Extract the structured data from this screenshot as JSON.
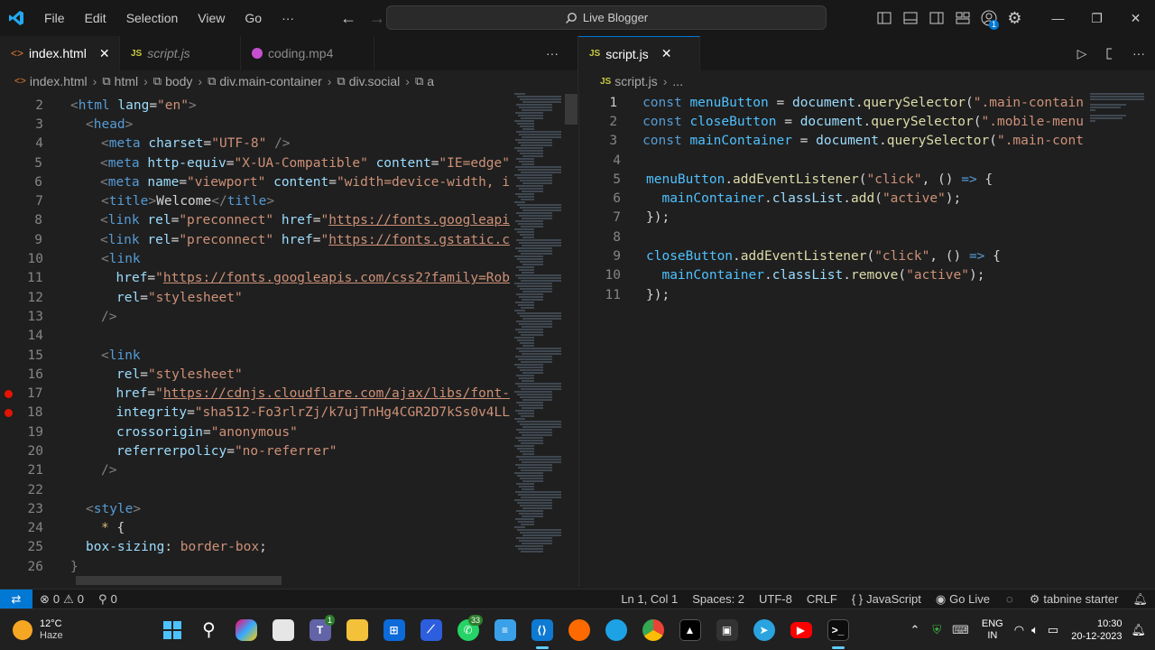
{
  "titlebar": {
    "menus": [
      "File",
      "Edit",
      "Selection",
      "View",
      "Go",
      "···"
    ],
    "search": "Live Blogger",
    "account_badge": "1"
  },
  "left_tabs": [
    {
      "label": "index.html",
      "icon": "html-icon",
      "active": true
    },
    {
      "label": "script.js",
      "icon": "js-icon",
      "active": false
    },
    {
      "label": "coding.mp4",
      "icon": "media-icon",
      "active": false
    }
  ],
  "left_tabs_more": "···",
  "right_tabs": [
    {
      "label": "script.js",
      "icon": "js-icon",
      "active": true
    }
  ],
  "left_breadcrumb": [
    "index.html",
    "html",
    "body",
    "div.main-container",
    "div.social",
    "a"
  ],
  "right_breadcrumb": [
    "script.js",
    "..."
  ],
  "html_lines": [
    {
      "n": "2",
      "html": "<span class=\"tag\">&lt;</span><span class=\"tname\">html</span> <span class=\"attr\">lang</span>=<span class=\"str\">\"en\"</span><span class=\"tag\">&gt;</span>",
      "indent": 0
    },
    {
      "n": "3",
      "html": "<span class=\"tag\">&lt;</span><span class=\"tname\">head</span><span class=\"tag\">&gt;</span>",
      "indent": 1
    },
    {
      "n": "4",
      "html": "<span class=\"tag\">&lt;</span><span class=\"tname\">meta</span> <span class=\"attr\">charset</span>=<span class=\"str\">\"UTF-8\"</span> <span class=\"tag\">/&gt;</span>",
      "indent": 2
    },
    {
      "n": "5",
      "html": "<span class=\"tag\">&lt;</span><span class=\"tname\">meta</span> <span class=\"attr\">http-equiv</span>=<span class=\"str\">\"X-UA-Compatible\"</span> <span class=\"attr\">content</span>=<span class=\"str\">\"IE=edge\"</span>",
      "indent": 2
    },
    {
      "n": "6",
      "html": "<span class=\"tag\">&lt;</span><span class=\"tname\">meta</span> <span class=\"attr\">name</span>=<span class=\"str\">\"viewport\"</span> <span class=\"attr\">content</span>=<span class=\"str\">\"width=device-width, i</span>",
      "indent": 2
    },
    {
      "n": "7",
      "html": "<span class=\"tag\">&lt;</span><span class=\"tname\">title</span><span class=\"tag\">&gt;</span>Welcome<span class=\"tag\">&lt;/</span><span class=\"tname\">title</span><span class=\"tag\">&gt;</span>",
      "indent": 2
    },
    {
      "n": "8",
      "html": "<span class=\"tag\">&lt;</span><span class=\"tname\">link</span> <span class=\"attr\">rel</span>=<span class=\"str\">\"preconnect\"</span> <span class=\"attr\">href</span>=<span class=\"str\">\"</span><span class=\"url\">https://fonts.googleapi</span>",
      "indent": 2
    },
    {
      "n": "9",
      "html": "<span class=\"tag\">&lt;</span><span class=\"tname\">link</span> <span class=\"attr\">rel</span>=<span class=\"str\">\"preconnect\"</span> <span class=\"attr\">href</span>=<span class=\"str\">\"</span><span class=\"url\">https://fonts.gstatic.c</span>",
      "indent": 2
    },
    {
      "n": "10",
      "html": "<span class=\"tag\">&lt;</span><span class=\"tname\">link</span>",
      "indent": 2
    },
    {
      "n": "11",
      "html": "<span class=\"attr\">href</span>=<span class=\"str\">\"</span><span class=\"url\">https://fonts.googleapis.com/css2?family=Rob</span>",
      "indent": 3
    },
    {
      "n": "12",
      "html": "<span class=\"attr\">rel</span>=<span class=\"str\">\"stylesheet\"</span>",
      "indent": 3
    },
    {
      "n": "13",
      "html": "<span class=\"tag\">/&gt;</span>",
      "indent": 2
    },
    {
      "n": "14",
      "html": "",
      "indent": 0
    },
    {
      "n": "15",
      "html": "<span class=\"tag\">&lt;</span><span class=\"tname\">link</span>",
      "indent": 2
    },
    {
      "n": "16",
      "html": "<span class=\"attr\">rel</span>=<span class=\"str\">\"stylesheet\"</span>",
      "indent": 3
    },
    {
      "n": "17",
      "html": "<span class=\"attr\">href</span>=<span class=\"str\">\"</span><span class=\"url\">https://cdnjs.cloudflare.com/ajax/libs/font-</span>",
      "indent": 3,
      "bp": true
    },
    {
      "n": "18",
      "html": "<span class=\"attr\">integrity</span>=<span class=\"str\">\"sha512-Fo3rlrZj/k7ujTnHg4CGR2D7kSs0v4LL</span>",
      "indent": 3,
      "bp": true
    },
    {
      "n": "19",
      "html": "<span class=\"attr\">crossorigin</span>=<span class=\"str\">\"anonymous\"</span>",
      "indent": 3
    },
    {
      "n": "20",
      "html": "<span class=\"attr\">referrerpolicy</span>=<span class=\"str\">\"no-referrer\"</span>",
      "indent": 3
    },
    {
      "n": "21",
      "html": "<span class=\"tag\">/&gt;</span>",
      "indent": 2
    },
    {
      "n": "22",
      "html": "",
      "indent": 0
    },
    {
      "n": "23",
      "html": "<span class=\"tag\">&lt;</span><span class=\"tname\">style</span><span class=\"tag\">&gt;</span>",
      "indent": 1
    },
    {
      "n": "24",
      "html": "<span class=\"sel\">*</span> {",
      "indent": 2
    },
    {
      "n": "25",
      "html": "<span class=\"cssprop\">box-sizing</span>: <span class=\"cssval\">border-box</span>;",
      "indent": 1
    },
    {
      "n": "26",
      "html": "<span class=\"tag\">}</span>",
      "indent": 0
    }
  ],
  "js_lines": [
    {
      "n": "1",
      "html": "<span class=\"kw\">const</span> <span class=\"var\">menuButton</span> = <span class=\"prop\">document</span>.<span class=\"fn\">querySelector</span>(<span class=\"str\">\".main-contain</span>"
    },
    {
      "n": "2",
      "html": "<span class=\"kw\">const</span> <span class=\"var\">closeButton</span> = <span class=\"prop\">document</span>.<span class=\"fn\">querySelector</span>(<span class=\"str\">\".mobile-menu</span>"
    },
    {
      "n": "3",
      "html": "<span class=\"kw\">const</span> <span class=\"var\">mainContainer</span> = <span class=\"prop\">document</span>.<span class=\"fn\">querySelector</span>(<span class=\"str\">\".main-cont</span>"
    },
    {
      "n": "4",
      "html": ""
    },
    {
      "n": "5",
      "html": "<span class=\"var\">menuButton</span>.<span class=\"fn\">addEventListener</span>(<span class=\"str\">\"click\"</span>, () <span class=\"kw\">=&gt;</span> {"
    },
    {
      "n": "6",
      "html": "  <span class=\"var\">mainContainer</span>.<span class=\"prop\">classList</span>.<span class=\"fn\">add</span>(<span class=\"str\">\"active\"</span>);"
    },
    {
      "n": "7",
      "html": "});"
    },
    {
      "n": "8",
      "html": ""
    },
    {
      "n": "9",
      "html": "<span class=\"var\">closeButton</span>.<span class=\"fn\">addEventListener</span>(<span class=\"str\">\"click\"</span>, () <span class=\"kw\">=&gt;</span> {"
    },
    {
      "n": "10",
      "html": "  <span class=\"var\">mainContainer</span>.<span class=\"prop\">classList</span>.<span class=\"fn\">remove</span>(<span class=\"str\">\"active\"</span>);"
    },
    {
      "n": "11",
      "html": "});"
    }
  ],
  "status": {
    "errors": "0",
    "warnings": "0",
    "ports": "0",
    "position": "Ln 1, Col 1",
    "spaces": "Spaces: 2",
    "encoding": "UTF-8",
    "eol": "CRLF",
    "language": "JavaScript",
    "golive": "Go Live",
    "tabnine": "tabnine starter"
  },
  "taskbar": {
    "weather_temp": "12°C",
    "weather_desc": "Haze",
    "teams_badge": "1",
    "whatsapp_badge": "33",
    "lang_top": "ENG",
    "lang_bottom": "IN",
    "time": "10:30",
    "date": "20-12-2023"
  },
  "colors": {
    "accent": "#0078d4",
    "breakpoint": "#e51400"
  }
}
